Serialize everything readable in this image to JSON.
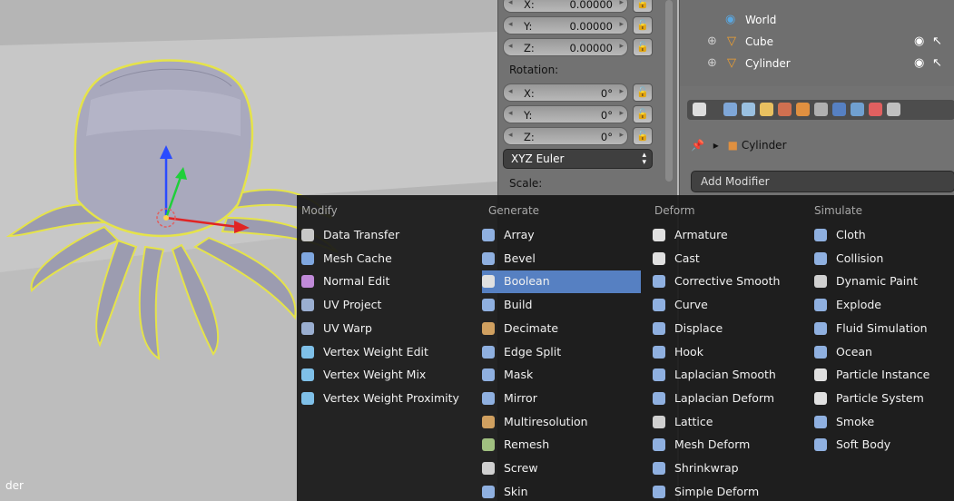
{
  "viewport": {
    "corner_label": "der"
  },
  "transform": {
    "loc_y_label": "Y:",
    "loc_y_value": "0.00000",
    "loc_z_label": "Z:",
    "loc_z_value": "0.00000",
    "rotation_label": "Rotation:",
    "rot_x_label": "X:",
    "rot_x_value": "0°",
    "rot_y_label": "Y:",
    "rot_y_value": "0°",
    "rot_z_label": "Z:",
    "rot_z_value": "0°",
    "rotation_mode": "XYZ Euler",
    "scale_label": "Scale:"
  },
  "outliner": {
    "items": [
      {
        "label": "World",
        "icon": "world-icon"
      },
      {
        "label": "Cube",
        "icon": "object-icon"
      },
      {
        "label": "Cylinder",
        "icon": "object-icon"
      }
    ]
  },
  "modifiers_panel": {
    "context_object": "Cylinder",
    "add_modifier_label": "Add Modifier"
  },
  "menu": {
    "columns": [
      {
        "header": "Modify",
        "items": [
          {
            "label": "Data Transfer",
            "icon": "data-transfer-icon",
            "color": "#c8c8c8"
          },
          {
            "label": "Mesh Cache",
            "icon": "mesh-cache-icon",
            "color": "#7fa7e0"
          },
          {
            "label": "Normal Edit",
            "icon": "normal-edit-icon",
            "color": "#c08ad8"
          },
          {
            "label": "UV Project",
            "icon": "uv-project-icon",
            "color": "#9aaed0"
          },
          {
            "label": "UV Warp",
            "icon": "uv-warp-icon",
            "color": "#9aaed0"
          },
          {
            "label": "Vertex Weight Edit",
            "icon": "vertex-weight-icon",
            "color": "#7fc0e8"
          },
          {
            "label": "Vertex Weight Mix",
            "icon": "vertex-weight-icon",
            "color": "#7fc0e8"
          },
          {
            "label": "Vertex Weight Proximity",
            "icon": "vertex-weight-icon",
            "color": "#7fc0e8"
          }
        ]
      },
      {
        "header": "Generate",
        "items": [
          {
            "label": "Array",
            "icon": "array-icon",
            "color": "#8fb0e0"
          },
          {
            "label": "Bevel",
            "icon": "bevel-icon",
            "color": "#8fb0e0"
          },
          {
            "label": "Boolean",
            "icon": "boolean-icon",
            "color": "#e0e0e0"
          },
          {
            "label": "Build",
            "icon": "build-icon",
            "color": "#8fb0e0"
          },
          {
            "label": "Decimate",
            "icon": "decimate-icon",
            "color": "#d0a060"
          },
          {
            "label": "Edge Split",
            "icon": "edge-split-icon",
            "color": "#8fb0e0"
          },
          {
            "label": "Mask",
            "icon": "mask-icon",
            "color": "#8fb0e0"
          },
          {
            "label": "Mirror",
            "icon": "mirror-icon",
            "color": "#8fb0e0"
          },
          {
            "label": "Multiresolution",
            "icon": "multires-icon",
            "color": "#d0a060"
          },
          {
            "label": "Remesh",
            "icon": "remesh-icon",
            "color": "#a0c080"
          },
          {
            "label": "Screw",
            "icon": "screw-icon",
            "color": "#d0d0d0"
          },
          {
            "label": "Skin",
            "icon": "skin-icon",
            "color": "#8fb0e0"
          }
        ]
      },
      {
        "header": "Deform",
        "items": [
          {
            "label": "Armature",
            "icon": "armature-icon",
            "color": "#e0e0e0"
          },
          {
            "label": "Cast",
            "icon": "cast-icon",
            "color": "#e0e0e0"
          },
          {
            "label": "Corrective Smooth",
            "icon": "smooth-icon",
            "color": "#8fb0e0"
          },
          {
            "label": "Curve",
            "icon": "curve-icon",
            "color": "#8fb0e0"
          },
          {
            "label": "Displace",
            "icon": "displace-icon",
            "color": "#8fb0e0"
          },
          {
            "label": "Hook",
            "icon": "hook-icon",
            "color": "#8fb0e0"
          },
          {
            "label": "Laplacian Smooth",
            "icon": "smooth-icon",
            "color": "#8fb0e0"
          },
          {
            "label": "Laplacian Deform",
            "icon": "laplacian-deform-icon",
            "color": "#8fb0e0"
          },
          {
            "label": "Lattice",
            "icon": "lattice-icon",
            "color": "#d0d0d0"
          },
          {
            "label": "Mesh Deform",
            "icon": "mesh-deform-icon",
            "color": "#8fb0e0"
          },
          {
            "label": "Shrinkwrap",
            "icon": "shrinkwrap-icon",
            "color": "#8fb0e0"
          },
          {
            "label": "Simple Deform",
            "icon": "simple-deform-icon",
            "color": "#8fb0e0"
          }
        ]
      },
      {
        "header": "Simulate",
        "items": [
          {
            "label": "Cloth",
            "icon": "cloth-icon",
            "color": "#8fb0e0"
          },
          {
            "label": "Collision",
            "icon": "collision-icon",
            "color": "#8fb0e0"
          },
          {
            "label": "Dynamic Paint",
            "icon": "dynamic-paint-icon",
            "color": "#d0d0d0"
          },
          {
            "label": "Explode",
            "icon": "explode-icon",
            "color": "#8fb0e0"
          },
          {
            "label": "Fluid Simulation",
            "icon": "fluid-icon",
            "color": "#8fb0e0"
          },
          {
            "label": "Ocean",
            "icon": "ocean-icon",
            "color": "#8fb0e0"
          },
          {
            "label": "Particle Instance",
            "icon": "particle-icon",
            "color": "#e0e0e0"
          },
          {
            "label": "Particle System",
            "icon": "particle-icon",
            "color": "#e0e0e0"
          },
          {
            "label": "Smoke",
            "icon": "smoke-icon",
            "color": "#8fb0e0"
          },
          {
            "label": "Soft Body",
            "icon": "soft-body-icon",
            "color": "#8fb0e0"
          }
        ]
      }
    ],
    "highlighted_item": "Boolean"
  }
}
